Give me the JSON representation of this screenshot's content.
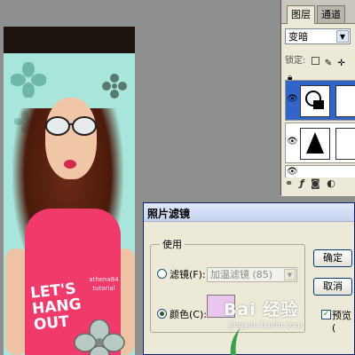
{
  "layers_panel": {
    "tabs": [
      "图层",
      "通道"
    ],
    "blend_mode": "变暗",
    "lock_label": "锁定:",
    "layers": [
      {
        "selected": true,
        "eye": "eye-icon"
      },
      {
        "selected": false,
        "eye": "eye-icon"
      },
      {
        "selected": false,
        "eye": "eye-icon"
      }
    ]
  },
  "canvas": {
    "shirt_text": "LET'S HANG OUT",
    "watermark": "athena84 tutorial"
  },
  "dialog": {
    "title": "照片滤镜",
    "use_group_label": "使用",
    "filter_radio_label": "滤镜(F):",
    "filter_value": "加温滤镜 (85)",
    "color_radio_label": "颜色(C):",
    "selected_option": "color",
    "color_swatch": "#e9c5ef",
    "ok_label": "确定",
    "cancel_label": "取消",
    "preview_label": "预览(",
    "preview_checked": true
  },
  "watermark": {
    "brand": "Bai 经验",
    "url": "jingyan.baidu.com"
  },
  "colors": {
    "canvas_bg": "#a8e6dc",
    "shirt": "#f03a6c",
    "layer_selected": "#3165c9",
    "dialog_bg": "#ece9d8"
  }
}
